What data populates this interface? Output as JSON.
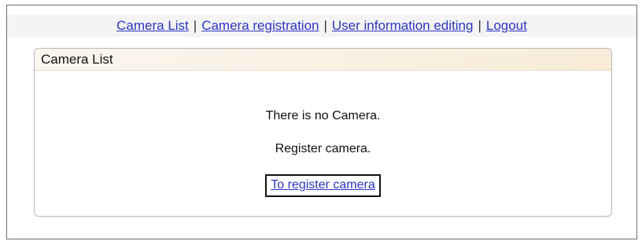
{
  "nav": {
    "items": [
      {
        "label": "Camera List"
      },
      {
        "label": "Camera registration"
      },
      {
        "label": "User information editing"
      },
      {
        "label": "Logout"
      }
    ],
    "separator": "|"
  },
  "panel": {
    "title": "Camera List",
    "empty_message": "There is no Camera.",
    "prompt": "Register camera.",
    "cta_label": "To register camera"
  },
  "colors": {
    "link": "#2b34c4",
    "panel_header_bg": "#f8ecd8",
    "nav_bg": "#f4f4f4"
  }
}
